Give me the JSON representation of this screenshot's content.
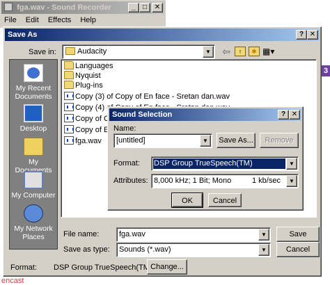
{
  "sound_recorder": {
    "title": "fga.wav - Sound Recorder",
    "menu": [
      "File",
      "Edit",
      "Effects",
      "Help"
    ]
  },
  "save_as": {
    "title": "Save As",
    "save_in_label": "Save in:",
    "save_in_value": "Audacity",
    "places": [
      {
        "label": "My Recent Documents",
        "icon": "recent-documents-icon"
      },
      {
        "label": "Desktop",
        "icon": "desktop-icon"
      },
      {
        "label": "My Documents",
        "icon": "my-documents-icon"
      },
      {
        "label": "My Computer",
        "icon": "my-computer-icon"
      },
      {
        "label": "My Network Places",
        "icon": "network-places-icon"
      }
    ],
    "files": [
      {
        "name": "Languages",
        "type": "folder"
      },
      {
        "name": "Nyquist",
        "type": "folder"
      },
      {
        "name": "Plug-ins",
        "type": "folder"
      },
      {
        "name": "Copy (3) of Copy of En face - Sretan dan.wav",
        "type": "wav"
      },
      {
        "name": "Copy (4) of Copy of En face - Sretan dan.wav",
        "type": "wav"
      },
      {
        "name": "Copy of Cop",
        "type": "wav"
      },
      {
        "name": "Copy of En f",
        "type": "wav"
      },
      {
        "name": "fga.wav",
        "type": "wav"
      }
    ],
    "file_name_label": "File name:",
    "file_name_value": "fga.wav",
    "save_as_type_label": "Save as type:",
    "save_as_type_value": "Sounds (*.wav)",
    "save_button": "Save",
    "cancel_button": "Cancel",
    "format_label": "Format:",
    "format_value": "DSP Group TrueSpeech(TM) 8,0",
    "change_button": "Change..."
  },
  "sound_selection": {
    "title": "Sound Selection",
    "name_label": "Name:",
    "name_value": "[untitled]",
    "save_as_button": "Save As...",
    "remove_button": "Remove",
    "format_label": "Format:",
    "format_value": "DSP Group TrueSpeech(TM)",
    "attributes_label": "Attributes:",
    "attributes_value": "8,000 kHz; 1 Bit; Mono",
    "attributes_rate": "1 kb/sec",
    "ok_button": "OK",
    "cancel_button": "Cancel"
  },
  "background_text": "encast",
  "help_glyph": "?",
  "close_glyph": "✕",
  "minimize_glyph": "_",
  "maximize_glyph": "□",
  "badge_text": "3"
}
